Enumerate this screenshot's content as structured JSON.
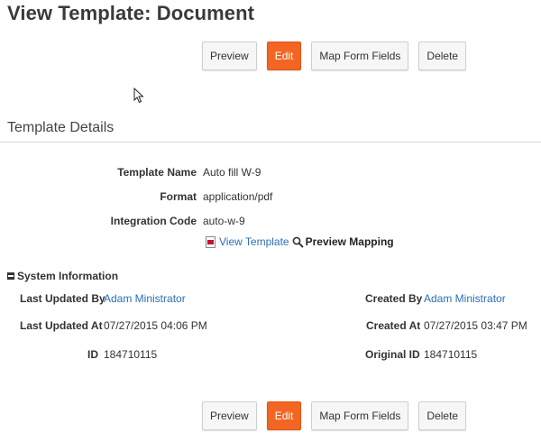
{
  "page": {
    "title": "View Template: Document"
  },
  "toolbar": {
    "preview_label": "Preview",
    "edit_label": "Edit",
    "map_label": "Map Form Fields",
    "delete_label": "Delete"
  },
  "details": {
    "section_title": "Template Details",
    "template_name_label": "Template Name",
    "template_name": "Auto fill W-9",
    "format_label": "Format",
    "format": "application/pdf",
    "integration_code_label": "Integration Code",
    "integration_code": "auto-w-9",
    "view_template_link": "View Template",
    "preview_mapping_link": "Preview Mapping"
  },
  "system": {
    "header": "System Information",
    "last_updated_by_label": "Last Updated By",
    "last_updated_by": "Adam Ministrator",
    "last_updated_at_label": "Last Updated At",
    "last_updated_at": "07/27/2015 04:06 PM",
    "id_label": "ID",
    "id": "184710115",
    "created_by_label": "Created By",
    "created_by": "Adam Ministrator",
    "created_at_label": "Created At",
    "created_at": "07/27/2015 03:47 PM",
    "original_id_label": "Original ID",
    "original_id": "184710115"
  },
  "colors": {
    "accent": "#f26522",
    "link": "#2a6ebb"
  }
}
